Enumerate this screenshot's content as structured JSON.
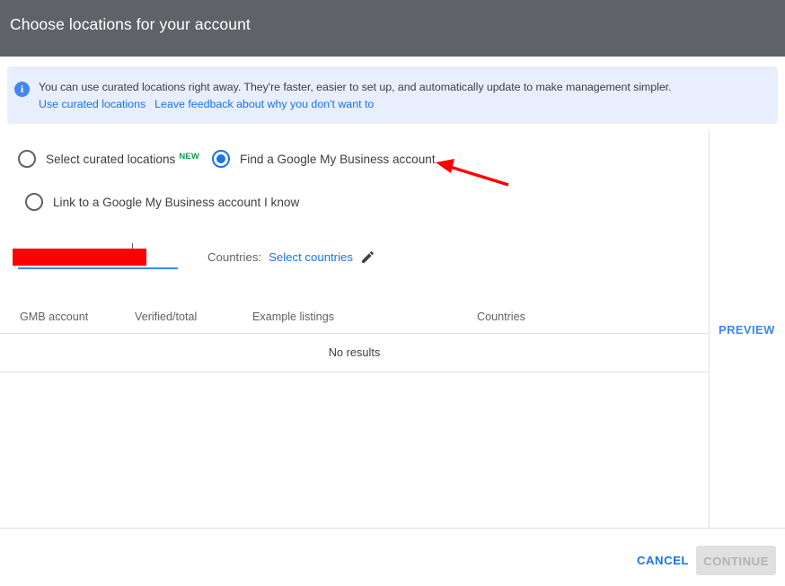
{
  "header": {
    "title": "Choose locations for your account"
  },
  "info_banner": {
    "icon": "info-icon",
    "message": "You can use curated locations right away. They're faster, easier to set up, and automatically update to make management simpler.",
    "links": [
      {
        "label": "Use curated locations"
      },
      {
        "label": "Leave feedback about why you don't want to"
      }
    ]
  },
  "location_source": {
    "options": [
      {
        "label": "Select curated locations",
        "badge": "NEW",
        "selected": false
      },
      {
        "label": "Find a Google My Business account",
        "selected": true
      },
      {
        "label": "Link to a Google My Business account I know",
        "selected": false
      }
    ]
  },
  "search": {
    "value": "",
    "placeholder": "",
    "redacted": true,
    "redaction_color": "#fe0000"
  },
  "countries": {
    "label": "Countries:",
    "link_label": "Select countries",
    "edit_icon": "pencil-icon"
  },
  "results_table": {
    "columns": [
      "GMB account",
      "Verified/total",
      "Example listings",
      "Countries"
    ],
    "rows": [],
    "empty_message": "No results"
  },
  "preview": {
    "label": "PREVIEW"
  },
  "footer": {
    "cancel_label": "CANCEL",
    "continue_label": "CONTINUE",
    "continue_disabled": true
  },
  "annotation": {
    "arrow": "red-arrow",
    "color": "#ff0000"
  },
  "colors": {
    "header_bg": "#5f6368",
    "banner_bg": "#e8eefc",
    "accent_blue": "#1a73e8",
    "badge_green": "#0f9d58",
    "annotation_red": "#ff0000"
  }
}
